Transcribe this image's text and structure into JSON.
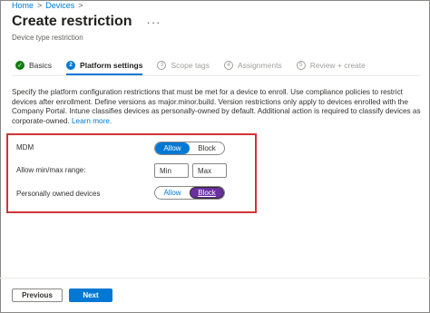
{
  "breadcrumb": {
    "items": [
      "Home",
      "Devices"
    ]
  },
  "header": {
    "title": "Create restriction",
    "more_icon": "ellipsis-icon",
    "subtitle": "Device type restriction"
  },
  "tabs": [
    {
      "label": "Basics",
      "state": "completed"
    },
    {
      "label": "Platform settings",
      "number": "2",
      "state": "active"
    },
    {
      "label": "Scope tags",
      "number": "3",
      "state": "pending"
    },
    {
      "label": "Assignments",
      "number": "4",
      "state": "pending"
    },
    {
      "label": "Review + create",
      "number": "5",
      "state": "pending"
    }
  ],
  "description": {
    "text": "Specify the platform configuration restrictions that must be met for a device to enroll. Use compliance policies to restrict devices after enrollment. Define versions as major.minor.build. Version restrictions only apply to devices enrolled with the Company Portal. Intune classifies devices as personally-owned by default. Additional action is required to classify devices as corporate-owned.",
    "link": "Learn more."
  },
  "settings": {
    "mdm": {
      "label": "MDM",
      "allow": "Allow",
      "block": "Block",
      "selected": "Allow"
    },
    "range": {
      "label": "Allow min/max range:",
      "min_placeholder": "Min",
      "max_placeholder": "Max"
    },
    "personal": {
      "label": "Personally owned devices",
      "allow": "Allow",
      "block": "Block",
      "selected": "Block"
    }
  },
  "footer": {
    "previous": "Previous",
    "next": "Next"
  },
  "colors": {
    "accent": "#0078d4",
    "highlight": "#d13438",
    "selected_block": "#6b2fa0",
    "success": "#107c10"
  }
}
